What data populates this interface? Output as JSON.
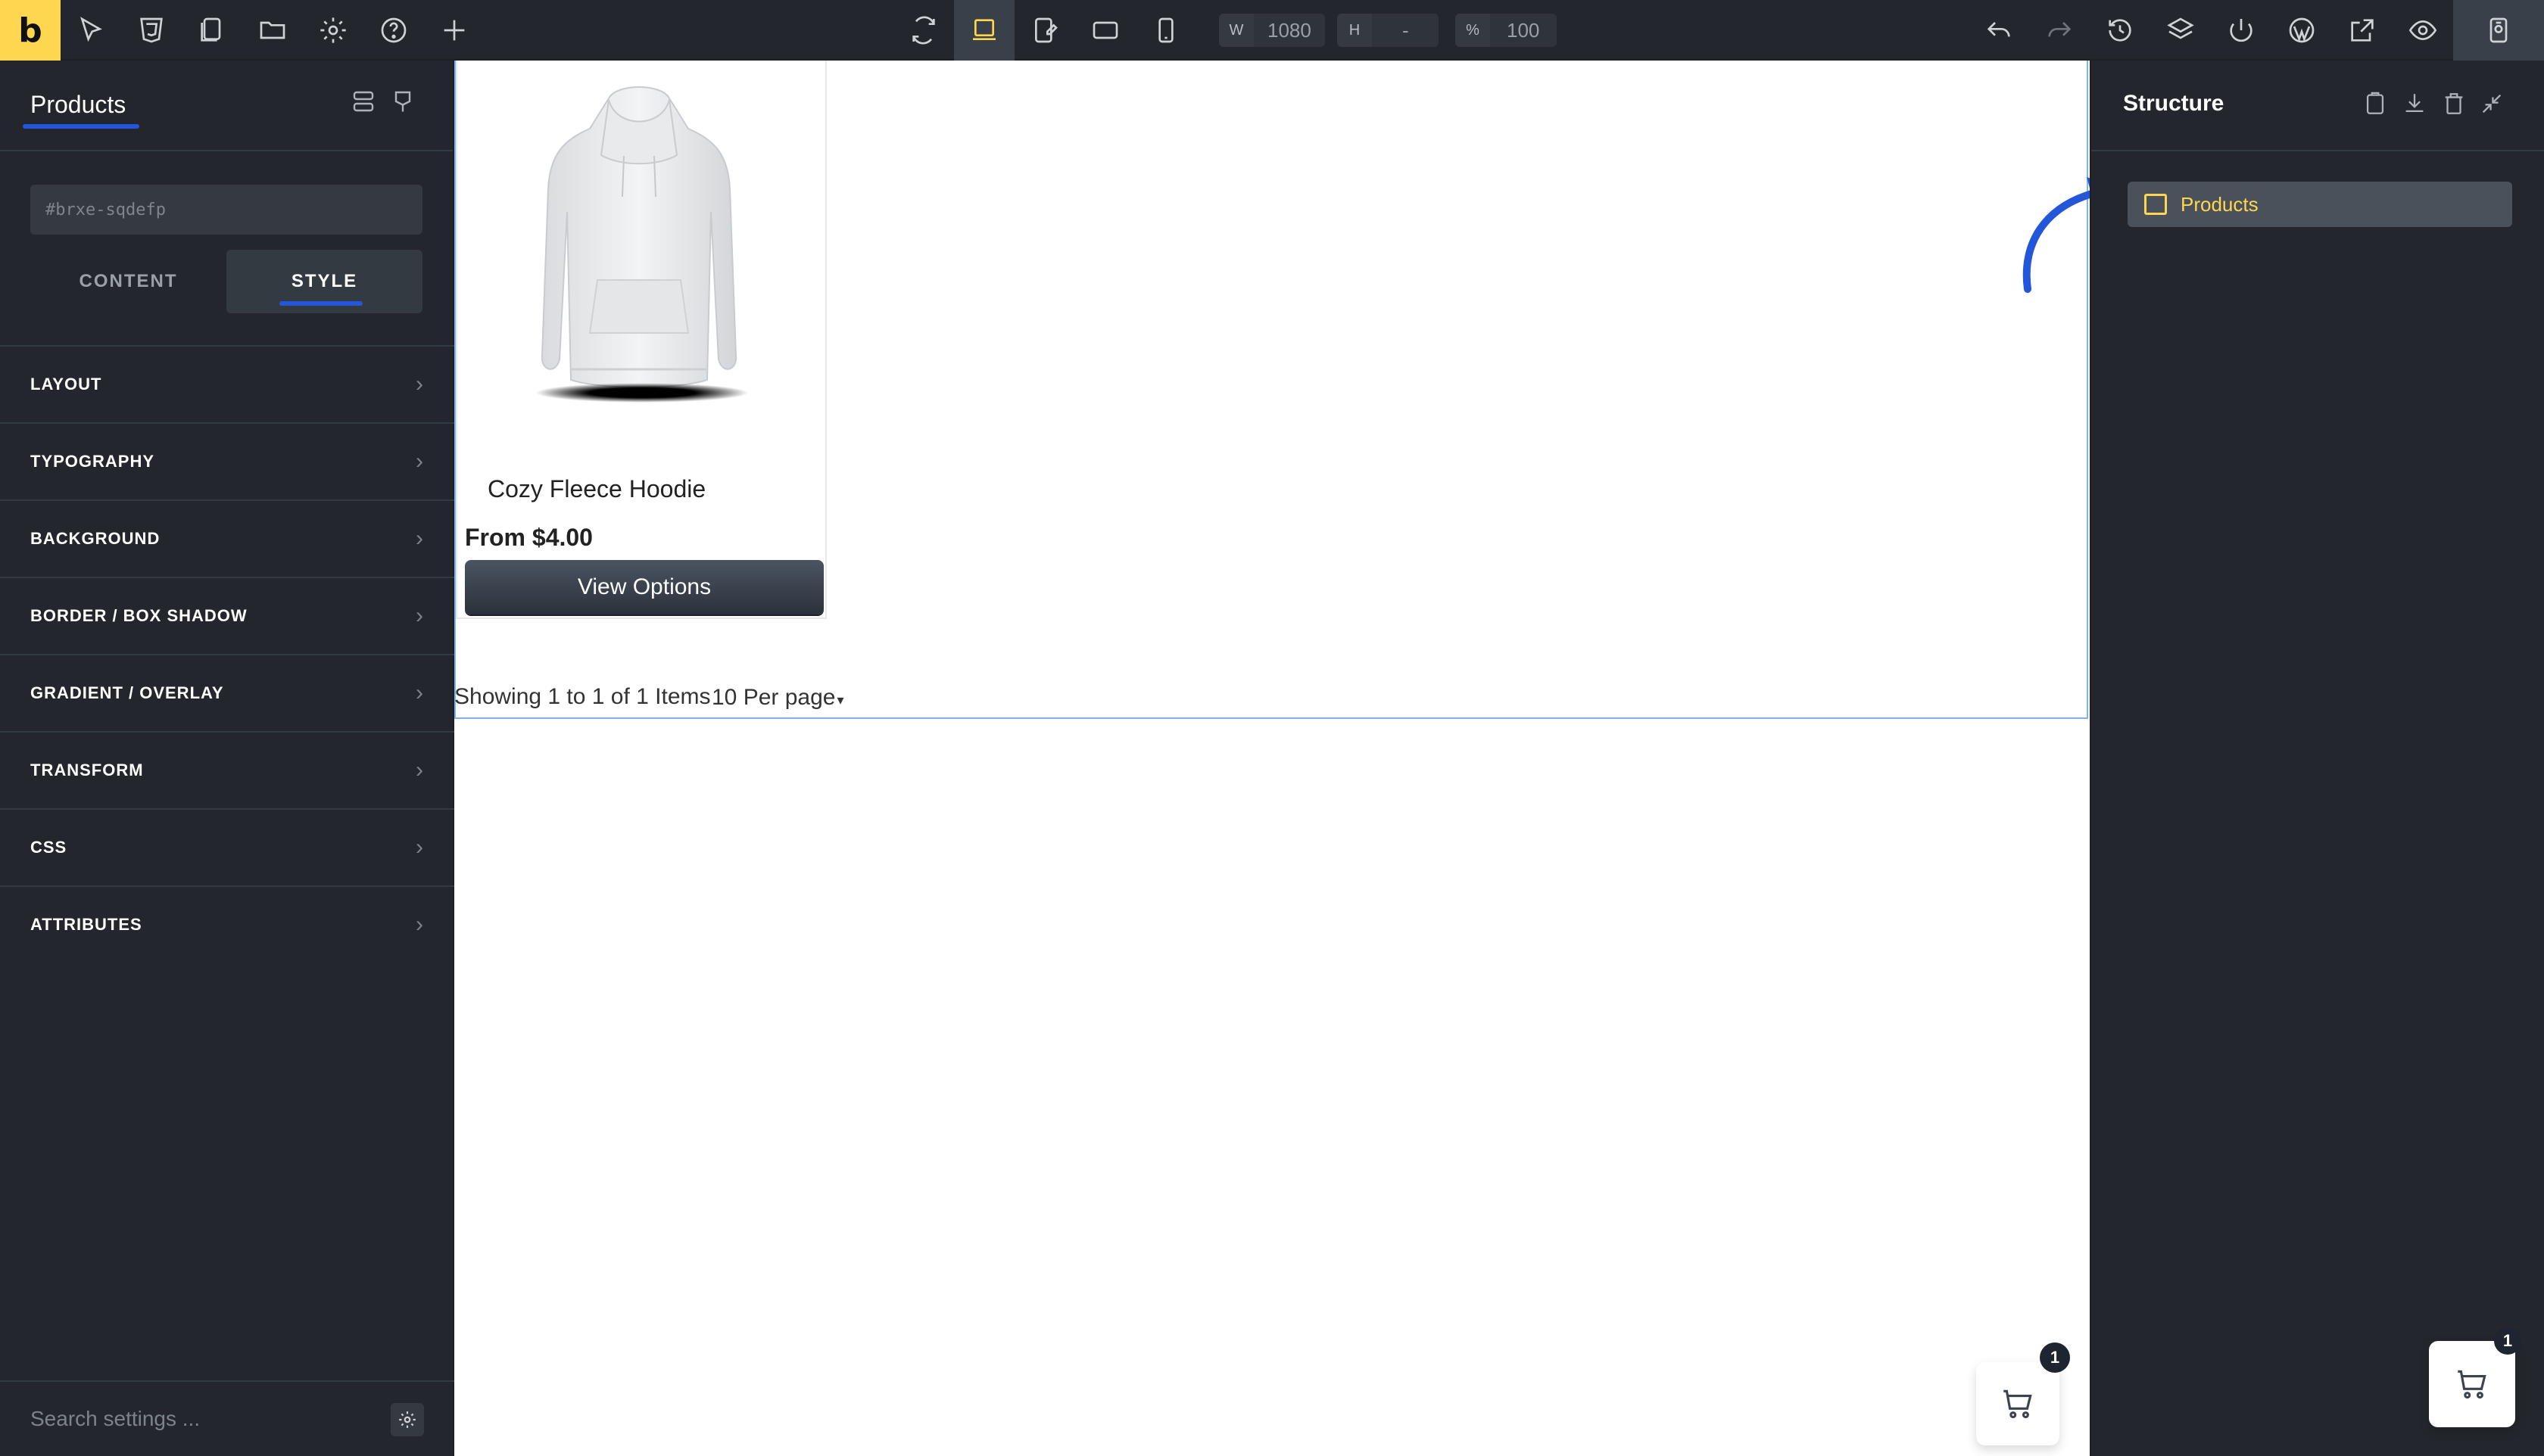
{
  "toolbar": {
    "logo": "b",
    "width_label": "W",
    "width_value": "1080",
    "height_label": "H",
    "height_value": "-",
    "zoom_label": "%",
    "zoom_value": "100"
  },
  "left_panel": {
    "title": "Products",
    "element_id": "#brxe-sqdefp",
    "tabs": [
      "CONTENT",
      "STYLE"
    ],
    "active_tab": "STYLE",
    "sections": [
      "LAYOUT",
      "TYPOGRAPHY",
      "BACKGROUND",
      "BORDER / BOX SHADOW",
      "GRADIENT / OVERLAY",
      "TRANSFORM",
      "CSS",
      "ATTRIBUTES"
    ],
    "search_placeholder": "Search settings ..."
  },
  "canvas": {
    "product_name": "Cozy Fleece Hoodie",
    "product_price": "From $4.00",
    "button_label": "View Options",
    "showing_text": "Showing 1 to 1 of 1 Items",
    "per_page_text": "10 Per page",
    "cart_count": "1"
  },
  "right_panel": {
    "title": "Structure",
    "node_label": "Products",
    "cart_count": "1"
  },
  "colors": {
    "accent": "#ffd64f",
    "panel": "#23272d",
    "blue": "#2356d8"
  }
}
